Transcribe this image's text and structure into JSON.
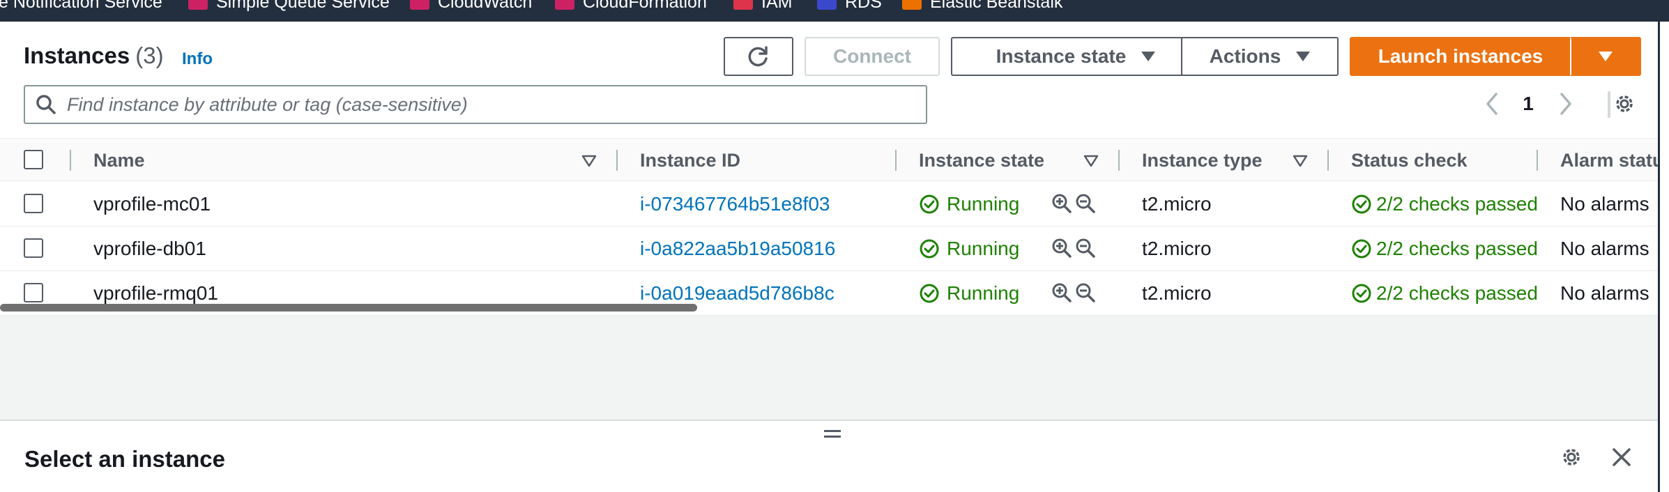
{
  "favorites": [
    {
      "label": "e Notification Service",
      "icon": "",
      "color": ""
    },
    {
      "label": "Simple Queue Service",
      "icon": "sqs-icon",
      "color": "#cc2264"
    },
    {
      "label": "CloudWatch",
      "icon": "cloudwatch-icon",
      "color": "#cc2264"
    },
    {
      "label": "CloudFormation",
      "icon": "cloudformation-icon",
      "color": "#cc2264"
    },
    {
      "label": "IAM",
      "icon": "iam-icon",
      "color": "#dd344c"
    },
    {
      "label": "RDS",
      "icon": "rds-icon",
      "color": "#3b48cc"
    },
    {
      "label": "Elastic Beanstalk",
      "icon": "beanstalk-icon",
      "color": "#ed7100"
    }
  ],
  "header": {
    "title": "Instances",
    "count": "(3)",
    "info": "Info"
  },
  "toolbar": {
    "refresh_icon": "refresh-icon",
    "connect": "Connect",
    "instance_state": "Instance state",
    "actions": "Actions",
    "launch": "Launch instances"
  },
  "search": {
    "placeholder": "Find instance by attribute or tag (case-sensitive)"
  },
  "pagination": {
    "page": "1"
  },
  "table": {
    "columns": [
      "Name",
      "Instance ID",
      "Instance state",
      "Instance type",
      "Status check",
      "Alarm status"
    ],
    "rows": [
      {
        "name": "vprofile-mc01",
        "id": "i-073467764b51e8f03",
        "state": "Running",
        "type": "t2.micro",
        "status": "2/2 checks passed",
        "alarm": "No alarms"
      },
      {
        "name": "vprofile-db01",
        "id": "i-0a822aa5b19a50816",
        "state": "Running",
        "type": "t2.micro",
        "status": "2/2 checks passed",
        "alarm": "No alarms"
      },
      {
        "name": "vprofile-rmq01",
        "id": "i-0a019eaad5d786b8c",
        "state": "Running",
        "type": "t2.micro",
        "status": "2/2 checks passed",
        "alarm": "No alarms"
      }
    ]
  },
  "details": {
    "title": "Select an instance"
  },
  "colors": {
    "accent": "#ec7211",
    "link": "#0073bb",
    "success": "#1d8102",
    "nav": "#232f3e"
  }
}
